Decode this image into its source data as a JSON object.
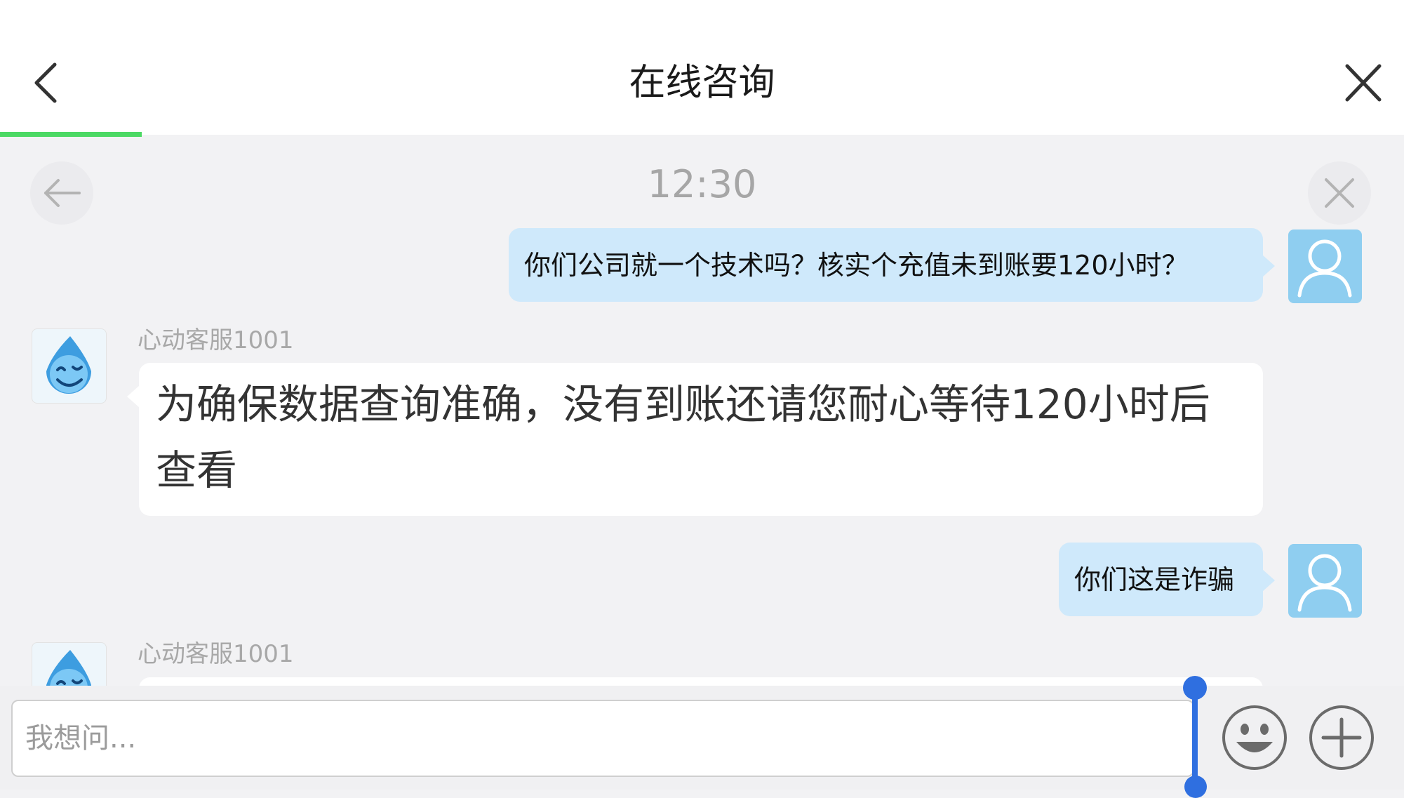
{
  "header": {
    "title": "在线咨询"
  },
  "chat": {
    "timestamp": "12:30",
    "messages": [
      {
        "direction": "outgoing",
        "text": "你们公司就一个技术吗？核实个充值未到账要120小时？"
      },
      {
        "direction": "incoming",
        "sender": "心动客服1001",
        "text": "为确保数据查询准确，没有到账还请您耐心等待120小时后查看"
      },
      {
        "direction": "outgoing",
        "text": "你们这是诈骗"
      },
      {
        "direction": "incoming",
        "sender": "心动客服1001",
        "text": ""
      }
    ]
  },
  "input": {
    "placeholder": "我想问..."
  },
  "colors": {
    "accent_progress": "#4cd964",
    "outgoing_bubble": "#cfe9fb",
    "incoming_bubble": "#ffffff",
    "background": "#f2f2f4",
    "caret": "#2f6fe0",
    "user_avatar": "#8fcef0"
  },
  "icons": {
    "back": "chevron-left-icon",
    "close": "close-x-icon",
    "float_back": "arrow-left-icon",
    "float_close": "close-x-icon",
    "emoji": "smiley-face-icon",
    "more": "plus-circle-icon",
    "user_avatar": "person-outline-icon",
    "agent_avatar": "water-drop-mascot-icon"
  }
}
